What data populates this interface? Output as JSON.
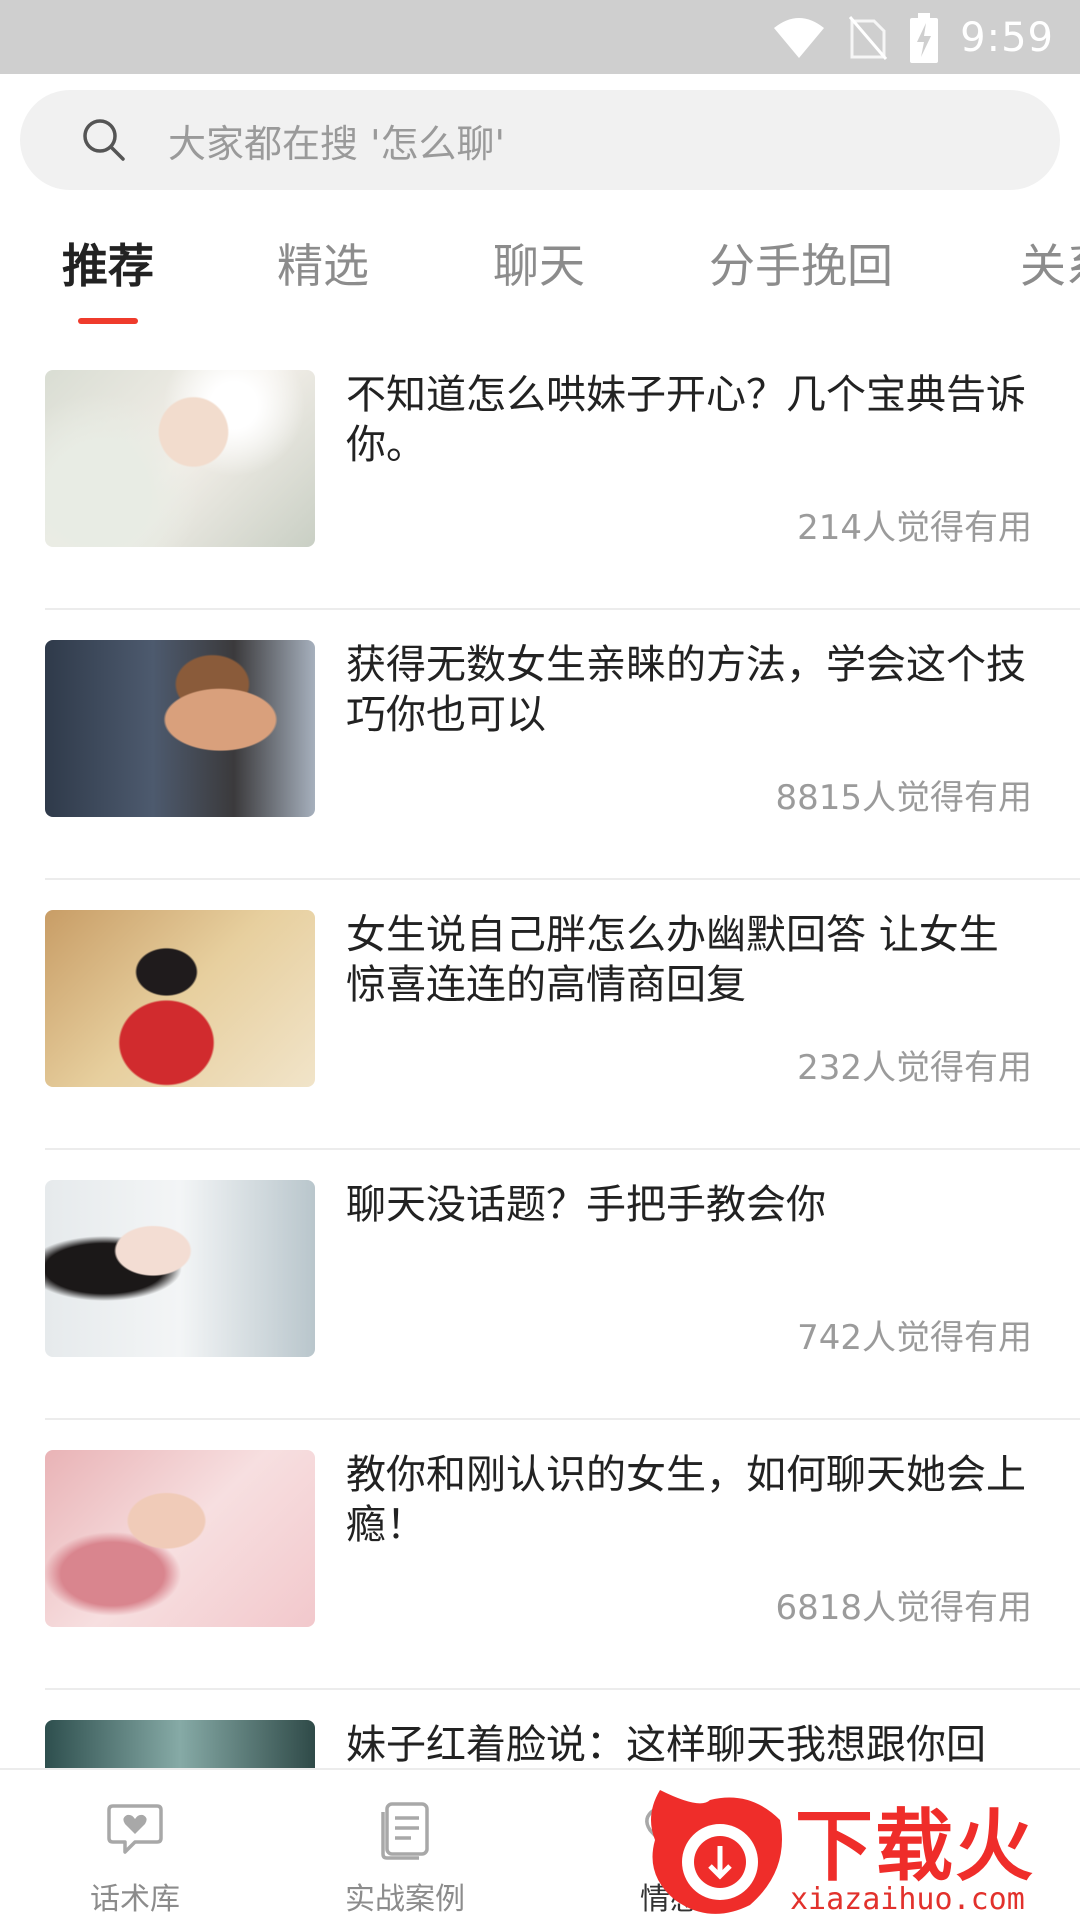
{
  "status_bar": {
    "time": "9:59"
  },
  "search": {
    "placeholder": "大家都在搜 '怎么聊'"
  },
  "tabs": [
    {
      "label": "推荐",
      "active": true
    },
    {
      "label": "精选"
    },
    {
      "label": "聊天"
    },
    {
      "label": "分手挽回"
    },
    {
      "label": "关系"
    }
  ],
  "articles": [
    {
      "title": "不知道怎么哄妹子开心？几个宝典告诉你。",
      "useful": "214人觉得有用"
    },
    {
      "title": "获得无数女生亲睐的方法，学会这个技巧你也可以",
      "useful": "8815人觉得有用"
    },
    {
      "title": "女生说自己胖怎么办幽默回答  让女生惊喜连连的高情商回复",
      "useful": "232人觉得有用"
    },
    {
      "title": "聊天没话题？手把手教会你",
      "useful": "742人觉得有用"
    },
    {
      "title": "教你和刚认识的女生，如何聊天她会上瘾！",
      "useful": "6818人觉得有用"
    },
    {
      "title": "妹子红着脸说：这样聊天我想跟你回",
      "useful": ""
    }
  ],
  "bottom_nav": [
    {
      "label": "话术库",
      "icon": "chat-bubble-icon"
    },
    {
      "label": "实战案例",
      "icon": "document-icon"
    },
    {
      "label": "情感",
      "icon": "heart-icon"
    }
  ],
  "watermark": {
    "text": "下载火",
    "sub": "xiazaihuo.com"
  },
  "colors": {
    "accent": "#ef3b2c",
    "status_bar": "#cfcfcf"
  }
}
